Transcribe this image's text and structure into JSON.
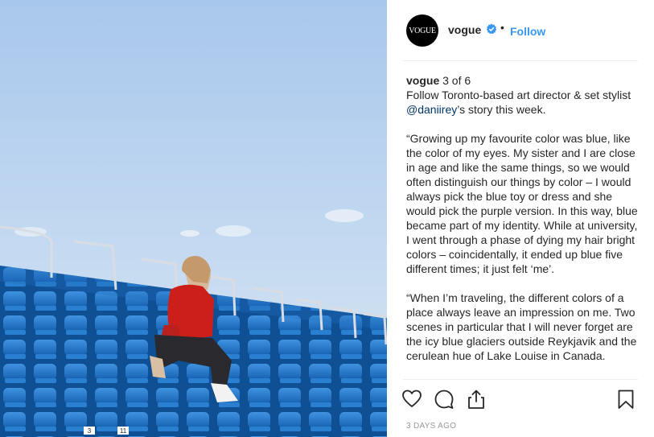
{
  "post": {
    "image_alt": "Woman in a red sweater sitting among empty blue stadium seats under a blue sky",
    "stand_numbers": [
      "3",
      "11"
    ]
  },
  "header": {
    "avatar_text": "VOGUE",
    "username": "vogue",
    "verified_icon": "verified-badge-icon",
    "separator": "•",
    "follow_label": "Follow"
  },
  "caption": {
    "username": "vogue",
    "intro_rest": " 3 of 6",
    "line2_a": "Follow Toronto-based art director & set stylist ",
    "mention": "@daniirey",
    "line2_b": "’s story this week.",
    "para1": "“Growing up my favourite color was blue, like the color of my eyes. My sister and I are close in age and like the same things, so we would often distinguish our things by color – I would always pick the blue toy or dress and she would pick the purple version. In this way, blue became part of my identity. While at university, I went through a phase of dying my hair bright colors – coincidentally, it ended up blue five different times; it just felt ‘me’.",
    "para2": "“When I’m traveling, the different colors of a place always leave an impression on me. Two scenes in particular that I will never forget are the icy blue glaciers outside Reykjavik and the cerulean hue of Lake Louise in Canada."
  },
  "actions": {
    "like_icon": "heart-icon",
    "comment_icon": "comment-icon",
    "share_icon": "share-icon",
    "save_icon": "bookmark-icon"
  },
  "timestamp": "3 DAYS AGO",
  "colors": {
    "follow": "#3897f0",
    "mention": "#003569",
    "verified": "#3897f0",
    "seat_blue": "#1a6fc4"
  }
}
